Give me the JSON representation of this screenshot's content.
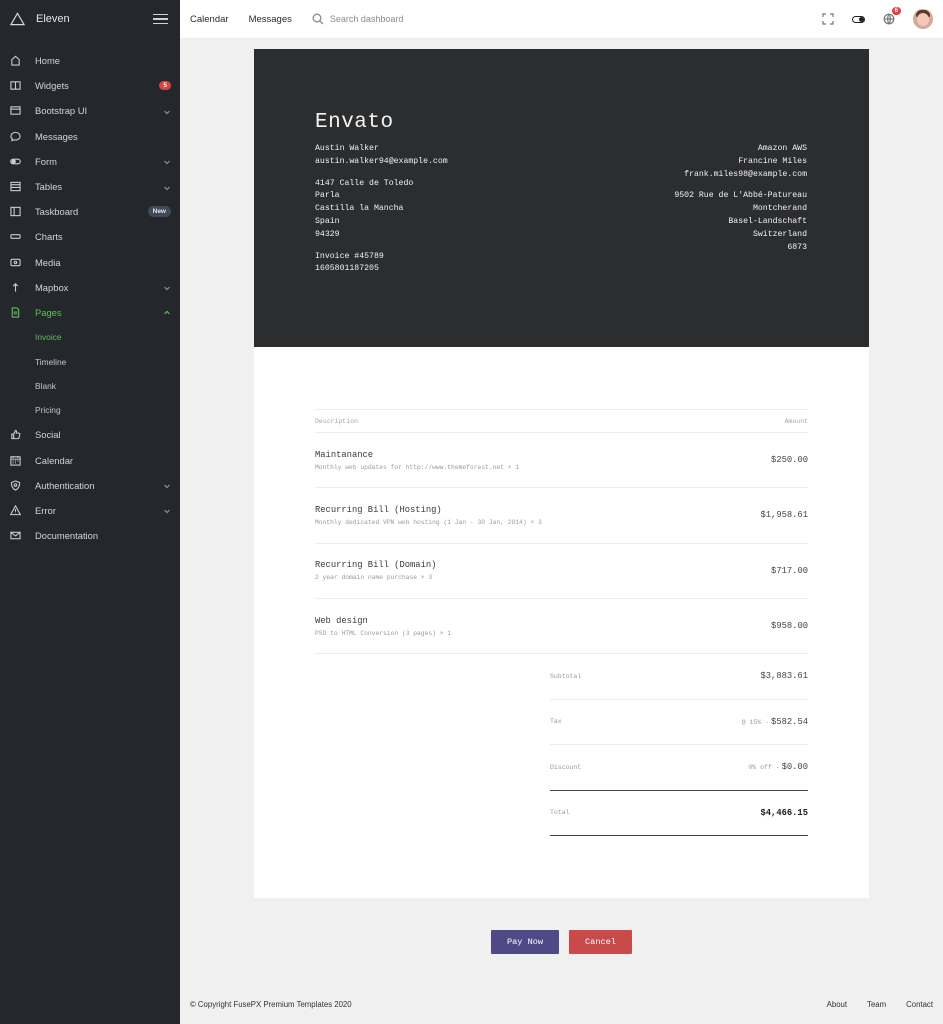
{
  "app": {
    "name": "Eleven"
  },
  "sidebar": {
    "items": [
      {
        "label": "Home",
        "icon": "home-icon"
      },
      {
        "label": "Widgets",
        "icon": "book-icon",
        "badge": "5"
      },
      {
        "label": "Bootstrap UI",
        "icon": "browser-icon",
        "expandable": true
      },
      {
        "label": "Messages",
        "icon": "chat-icon"
      },
      {
        "label": "Form",
        "icon": "toggle-icon",
        "expandable": true
      },
      {
        "label": "Tables",
        "icon": "table-icon",
        "expandable": true
      },
      {
        "label": "Taskboard",
        "icon": "columns-icon",
        "badge_new": "New"
      },
      {
        "label": "Charts",
        "icon": "chart-icon"
      },
      {
        "label": "Media",
        "icon": "media-icon"
      },
      {
        "label": "Mapbox",
        "icon": "map-pin-icon",
        "expandable": true
      },
      {
        "label": "Pages",
        "icon": "document-icon",
        "expandable": true,
        "active": true
      },
      {
        "label": "Social",
        "icon": "thumbs-up-icon"
      },
      {
        "label": "Calendar",
        "icon": "calendar-icon"
      },
      {
        "label": "Authentication",
        "icon": "shield-icon",
        "expandable": true
      },
      {
        "label": "Error",
        "icon": "warning-icon",
        "expandable": true
      },
      {
        "label": "Documentation",
        "icon": "mail-icon"
      }
    ],
    "pages_sub": [
      {
        "label": "Invoice",
        "active": true
      },
      {
        "label": "Timeline"
      },
      {
        "label": "Blank"
      },
      {
        "label": "Pricing"
      }
    ]
  },
  "topbar": {
    "links": [
      "Calendar",
      "Messages"
    ],
    "search_placeholder": "Search dashboard",
    "notifications_count": "6"
  },
  "invoice": {
    "company": "Envato",
    "from": {
      "name": "Austin Walker",
      "email": "austin.walker94@example.com",
      "street": "4147 Calle de Toledo",
      "city": "Parla",
      "region": "Castilla la Mancha",
      "country": "Spain",
      "postal": "94329",
      "invoice_no": "Invoice #45789",
      "timestamp": "1605801187205"
    },
    "to": {
      "company": "Amazon AWS",
      "name": "Francine Miles",
      "email": "frank.miles98@example.com",
      "street": "9502 Rue de L'Abbé-Patureau",
      "city": "Montcherand",
      "region": "Basel-Landschaft",
      "country": "Switzerland",
      "postal": "6873"
    },
    "columns": {
      "description": "Description",
      "amount": "Amount"
    },
    "items": [
      {
        "title": "Maintanance",
        "detail": "Monthly web updates for http://www.themeforest.net × 1",
        "amount": "$250.00"
      },
      {
        "title": "Recurring Bill (Hosting)",
        "detail": "Monthly dedicated VPN web hosting (1 Jan - 30 Jan, 2014) × 3",
        "amount": "$1,958.61"
      },
      {
        "title": "Recurring Bill (Domain)",
        "detail": "2 year domain name purchase × 3",
        "amount": "$717.00"
      },
      {
        "title": "Web design",
        "detail": "PSD to HTML Conversion (3 pages) × 1",
        "amount": "$958.00"
      }
    ],
    "totals": {
      "subtotal_label": "Subtotal",
      "subtotal": "$3,883.61",
      "tax_label": "Tax",
      "tax_note": "@ 15% -",
      "tax": "$582.54",
      "discount_label": "Discount",
      "discount_note": "0% off -",
      "discount": "$0.00",
      "total_label": "Total",
      "total": "$4,466.15"
    }
  },
  "actions": {
    "pay": "Pay Now",
    "cancel": "Cancel"
  },
  "footer": {
    "copyright": "© Copyright FusePX Premium Templates 2020",
    "links": [
      "About",
      "Team",
      "Contact"
    ]
  },
  "colors": {
    "sidebar_bg": "#24272b",
    "accent_green": "#5fbf5f",
    "pay_button": "#4f4a86",
    "cancel_button": "#c94a4a",
    "invoice_header": "#2c2d2f",
    "badge_red": "#d9453d"
  }
}
